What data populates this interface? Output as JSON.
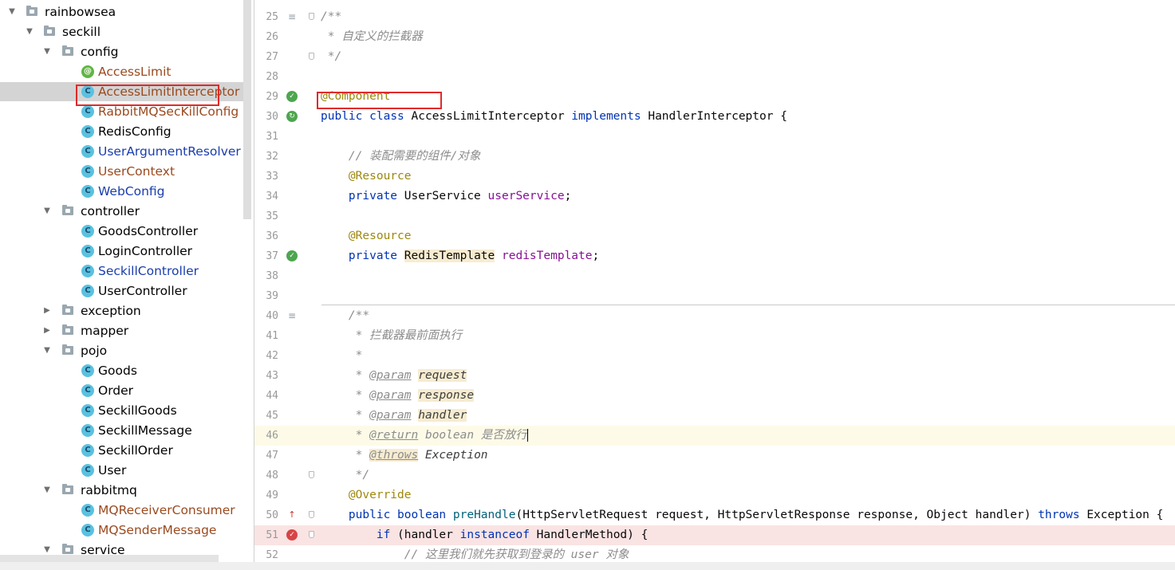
{
  "project_tree": {
    "nodes": [
      {
        "label": "rainbowsea",
        "type": "folder",
        "level": 0,
        "expanded": true
      },
      {
        "label": "seckill",
        "type": "folder",
        "level": 1,
        "expanded": true
      },
      {
        "label": "config",
        "type": "folder",
        "level": 2,
        "expanded": true
      },
      {
        "label": "AccessLimit",
        "type": "annotation",
        "level": 3,
        "color": "brown"
      },
      {
        "label": "AccessLimitInterceptor",
        "type": "class",
        "level": 3,
        "color": "brown",
        "selected": true
      },
      {
        "label": "RabbitMQSecKillConfig",
        "type": "class",
        "level": 3,
        "color": "brown"
      },
      {
        "label": "RedisConfig",
        "type": "class",
        "level": 3,
        "color": "normal"
      },
      {
        "label": "UserArgumentResolver",
        "type": "class",
        "level": 3,
        "color": "blue"
      },
      {
        "label": "UserContext",
        "type": "class",
        "level": 3,
        "color": "brown"
      },
      {
        "label": "WebConfig",
        "type": "class",
        "level": 3,
        "color": "blue"
      },
      {
        "label": "controller",
        "type": "folder",
        "level": 2,
        "expanded": true
      },
      {
        "label": "GoodsController",
        "type": "class",
        "level": 3,
        "color": "normal"
      },
      {
        "label": "LoginController",
        "type": "class",
        "level": 3,
        "color": "normal"
      },
      {
        "label": "SeckillController",
        "type": "class",
        "level": 3,
        "color": "blue"
      },
      {
        "label": "UserController",
        "type": "class",
        "level": 3,
        "color": "normal"
      },
      {
        "label": "exception",
        "type": "folder",
        "level": 2,
        "expanded": false
      },
      {
        "label": "mapper",
        "type": "folder",
        "level": 2,
        "expanded": false
      },
      {
        "label": "pojo",
        "type": "folder",
        "level": 2,
        "expanded": true
      },
      {
        "label": "Goods",
        "type": "class",
        "level": 3,
        "color": "normal"
      },
      {
        "label": "Order",
        "type": "class",
        "level": 3,
        "color": "normal"
      },
      {
        "label": "SeckillGoods",
        "type": "class",
        "level": 3,
        "color": "normal"
      },
      {
        "label": "SeckillMessage",
        "type": "class",
        "level": 3,
        "color": "normal"
      },
      {
        "label": "SeckillOrder",
        "type": "class",
        "level": 3,
        "color": "normal"
      },
      {
        "label": "User",
        "type": "class",
        "level": 3,
        "color": "normal"
      },
      {
        "label": "rabbitmq",
        "type": "folder",
        "level": 2,
        "expanded": true
      },
      {
        "label": "MQReceiverConsumer",
        "type": "class",
        "level": 3,
        "color": "brown"
      },
      {
        "label": "MQSenderMessage",
        "type": "class",
        "level": 3,
        "color": "brown"
      },
      {
        "label": "service",
        "type": "folder",
        "level": 2,
        "expanded": true
      }
    ]
  },
  "editor": {
    "highlight_line": "46",
    "breakpoint_line": "51",
    "lines": [
      {
        "num": "25",
        "gutter": "doc",
        "fold": true,
        "tokens": [
          {
            "t": "/**",
            "c": "cm"
          }
        ]
      },
      {
        "num": "26",
        "tokens": [
          {
            "t": " * 自定义的拦截器",
            "c": "cm"
          }
        ]
      },
      {
        "num": "27",
        "fold": true,
        "tokens": [
          {
            "t": " */",
            "c": "cm"
          }
        ]
      },
      {
        "num": "28",
        "tokens": []
      },
      {
        "num": "29",
        "gutter": "bean",
        "tokens": [
          {
            "t": "@Component",
            "c": "ann"
          }
        ]
      },
      {
        "num": "30",
        "gutter": "imp",
        "tokens": [
          {
            "t": "public",
            "c": "kw"
          },
          {
            "t": " "
          },
          {
            "t": "class",
            "c": "kw"
          },
          {
            "t": " AccessLimitInterceptor "
          },
          {
            "t": "implements",
            "c": "kw"
          },
          {
            "t": " HandlerInterceptor {"
          }
        ]
      },
      {
        "num": "31",
        "tokens": []
      },
      {
        "num": "32",
        "tokens": [
          {
            "t": "    "
          },
          {
            "t": "// 装配需要的组件/对象",
            "c": "cm"
          }
        ]
      },
      {
        "num": "33",
        "tokens": [
          {
            "t": "    "
          },
          {
            "t": "@Resource",
            "c": "ann"
          }
        ]
      },
      {
        "num": "34",
        "tokens": [
          {
            "t": "    "
          },
          {
            "t": "private",
            "c": "kw"
          },
          {
            "t": " UserService "
          },
          {
            "t": "userService",
            "c": "fld"
          },
          {
            "t": ";"
          }
        ]
      },
      {
        "num": "35",
        "tokens": []
      },
      {
        "num": "36",
        "tokens": [
          {
            "t": "    "
          },
          {
            "t": "@Resource",
            "c": "ann"
          }
        ]
      },
      {
        "num": "37",
        "gutter": "bean",
        "tokens": [
          {
            "t": "    "
          },
          {
            "t": "private",
            "c": "kw"
          },
          {
            "t": " "
          },
          {
            "t": "RedisTemplate",
            "c": "hlt"
          },
          {
            "t": " "
          },
          {
            "t": "redisTemplate",
            "c": "fld"
          },
          {
            "t": ";"
          }
        ]
      },
      {
        "num": "38",
        "tokens": []
      },
      {
        "num": "39",
        "tokens": []
      },
      {
        "num": "40",
        "gutter": "doc",
        "tokens": [
          {
            "t": "    "
          },
          {
            "t": "/**",
            "c": "cm"
          }
        ]
      },
      {
        "num": "41",
        "tokens": [
          {
            "t": "     "
          },
          {
            "t": "* 拦截器最前面执行",
            "c": "cm"
          }
        ]
      },
      {
        "num": "42",
        "tokens": [
          {
            "t": "     "
          },
          {
            "t": "*",
            "c": "cm"
          }
        ]
      },
      {
        "num": "43",
        "tokens": [
          {
            "t": "     "
          },
          {
            "t": "* ",
            "c": "cm"
          },
          {
            "t": "@param",
            "c": "dtag"
          },
          {
            "t": " ",
            "c": "cm"
          },
          {
            "t": "request",
            "c": "dparam"
          }
        ]
      },
      {
        "num": "44",
        "tokens": [
          {
            "t": "     "
          },
          {
            "t": "* ",
            "c": "cm"
          },
          {
            "t": "@param",
            "c": "dtag"
          },
          {
            "t": " ",
            "c": "cm"
          },
          {
            "t": "response",
            "c": "dparam"
          }
        ]
      },
      {
        "num": "45",
        "tokens": [
          {
            "t": "     "
          },
          {
            "t": "* ",
            "c": "cm"
          },
          {
            "t": "@param",
            "c": "dtag"
          },
          {
            "t": " ",
            "c": "cm"
          },
          {
            "t": "handler",
            "c": "dparam"
          }
        ]
      },
      {
        "num": "46",
        "tokens": [
          {
            "t": "     "
          },
          {
            "t": "* ",
            "c": "cm"
          },
          {
            "t": "@return",
            "c": "dtag"
          },
          {
            "t": " boolean 是否放行",
            "c": "cm"
          },
          {
            "t": "",
            "c": "caret"
          }
        ]
      },
      {
        "num": "47",
        "tokens": [
          {
            "t": "     "
          },
          {
            "t": "* ",
            "c": "cm"
          },
          {
            "t": "@throws",
            "c": "dtag hlt"
          },
          {
            "t": " ",
            "c": "cm"
          },
          {
            "t": "Exception",
            "c": "dexc"
          }
        ]
      },
      {
        "num": "48",
        "fold": true,
        "tokens": [
          {
            "t": "     "
          },
          {
            "t": "*/",
            "c": "cm"
          }
        ]
      },
      {
        "num": "49",
        "tokens": [
          {
            "t": "    "
          },
          {
            "t": "@Override",
            "c": "ann"
          }
        ]
      },
      {
        "num": "50",
        "gutter": "ovr",
        "fold": true,
        "tokens": [
          {
            "t": "    "
          },
          {
            "t": "public",
            "c": "kw"
          },
          {
            "t": " "
          },
          {
            "t": "boolean",
            "c": "kw"
          },
          {
            "t": " "
          },
          {
            "t": "preHandle",
            "c": "mth"
          },
          {
            "t": "(HttpServletRequest request, HttpServletResponse response, Object handler) "
          },
          {
            "t": "throws",
            "c": "kw"
          },
          {
            "t": " Exception {"
          }
        ]
      },
      {
        "num": "51",
        "gutter": "bpt",
        "fold": true,
        "tokens": [
          {
            "t": "        "
          },
          {
            "t": "if",
            "c": "kw"
          },
          {
            "t": " (handler "
          },
          {
            "t": "instanceof",
            "c": "kw"
          },
          {
            "t": " HandlerMethod) {"
          }
        ]
      },
      {
        "num": "52",
        "tokens": [
          {
            "t": "            "
          },
          {
            "t": "// 这里我们就先获取到登录的 user 对象",
            "c": "cm"
          }
        ]
      }
    ]
  }
}
